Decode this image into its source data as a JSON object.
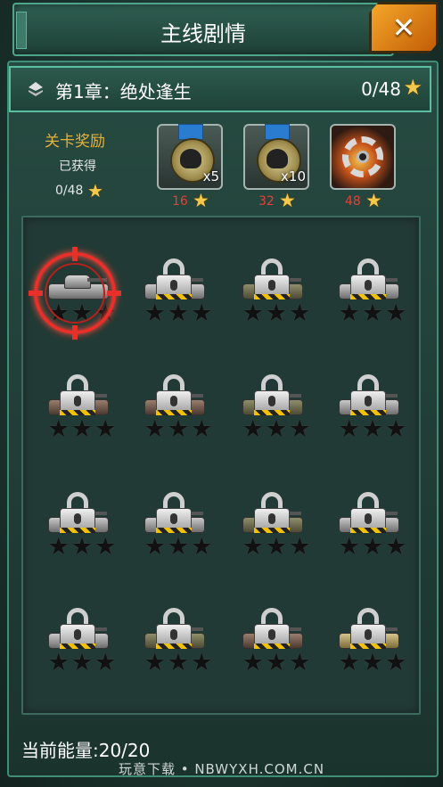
{
  "window": {
    "title": "主线剧情",
    "close_icon": "close-icon"
  },
  "chapter": {
    "title": "第1章：绝处逢生",
    "progress": "0/48",
    "icon": "chapter-icon"
  },
  "rewards": {
    "title": "关卡奖励",
    "subtitle": "已获得",
    "earned": "0/48",
    "items": [
      {
        "icon": "skull-medal-icon",
        "multiplier": "x5",
        "required": "16"
      },
      {
        "icon": "skull-medal-icon",
        "multiplier": "x10",
        "required": "32"
      },
      {
        "icon": "gear-icon",
        "multiplier": "",
        "required": "48"
      }
    ]
  },
  "stages": [
    {
      "variant": "gray",
      "locked": false,
      "selected": true
    },
    {
      "variant": "gray",
      "locked": true
    },
    {
      "variant": "camo",
      "locked": true
    },
    {
      "variant": "gray",
      "locked": true
    },
    {
      "variant": "brown",
      "locked": true
    },
    {
      "variant": "brown",
      "locked": true
    },
    {
      "variant": "camo",
      "locked": true
    },
    {
      "variant": "gray",
      "locked": true
    },
    {
      "variant": "gray",
      "locked": true
    },
    {
      "variant": "gray",
      "locked": true
    },
    {
      "variant": "camo",
      "locked": true
    },
    {
      "variant": "gray",
      "locked": true
    },
    {
      "variant": "gray",
      "locked": true
    },
    {
      "variant": "camo",
      "locked": true
    },
    {
      "variant": "brown",
      "locked": true
    },
    {
      "variant": "desert",
      "locked": true
    }
  ],
  "footer": {
    "energy": "当前能量:20/20",
    "watermark": "玩意下载 • NBWYXH.COM.CN"
  },
  "colors": {
    "accent": "#5bbf9f",
    "gold": "#e8b23a",
    "red": "#e2403a",
    "close": "#f4a62a"
  }
}
